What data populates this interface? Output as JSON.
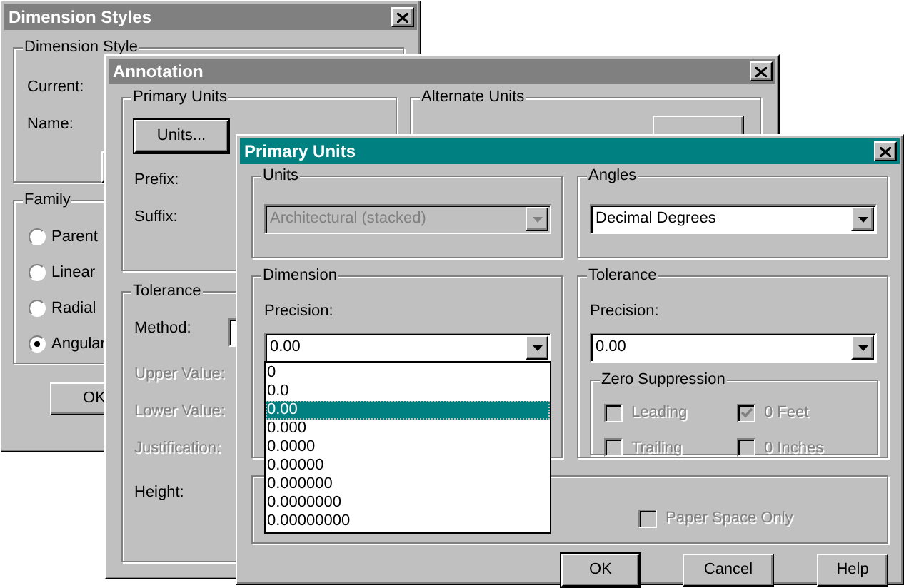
{
  "dimension_styles": {
    "title": "Dimension Styles",
    "active": false,
    "dimension_style": {
      "label": "Dimension Style",
      "fields": [
        "Current:",
        "Name:"
      ]
    },
    "family": {
      "label": "Family",
      "options": [
        {
          "label": "Parent",
          "selected": false
        },
        {
          "label": "Linear",
          "selected": false
        },
        {
          "label": "Radial",
          "selected": false
        },
        {
          "label": "Angular",
          "selected": true
        }
      ]
    },
    "buttons": [
      "OK"
    ]
  },
  "annotation": {
    "title": "Annotation",
    "active": false,
    "primary_units": {
      "label": "Primary Units",
      "button": "Units...",
      "fields": [
        "Prefix:",
        "Suffix:"
      ]
    },
    "alternate_units": {
      "label": "Alternate Units"
    },
    "tolerance": {
      "label": "Tolerance",
      "fields": [
        {
          "label": "Method:",
          "disabled": false
        },
        {
          "label": "Upper Value:",
          "disabled": true
        },
        {
          "label": "Lower Value:",
          "disabled": true
        },
        {
          "label": "Justification:",
          "disabled": true
        },
        {
          "label": "Height:",
          "disabled": false
        }
      ]
    }
  },
  "primary_units": {
    "title": "Primary Units",
    "active": true,
    "units": {
      "label": "Units",
      "value": "Architectural (stacked)",
      "disabled": true
    },
    "angles": {
      "label": "Angles",
      "value": "Decimal Degrees",
      "disabled": false
    },
    "dimension": {
      "label": "Dimension",
      "precision_label": "Precision:",
      "value": "0.00",
      "expanded": true,
      "options": [
        {
          "label": "0",
          "selected": false
        },
        {
          "label": "0.0",
          "selected": false
        },
        {
          "label": "0.00",
          "selected": true
        },
        {
          "label": "0.000",
          "selected": false
        },
        {
          "label": "0.0000",
          "selected": false
        },
        {
          "label": "0.00000",
          "selected": false
        },
        {
          "label": "0.000000",
          "selected": false
        },
        {
          "label": "0.0000000",
          "selected": false
        },
        {
          "label": "0.00000000",
          "selected": false
        }
      ]
    },
    "tolerance": {
      "label": "Tolerance",
      "precision_label": "Precision:",
      "value": "0.00",
      "zero_suppression": {
        "label": "Zero Suppression",
        "options": [
          {
            "label": "Leading",
            "checked": false,
            "disabled": true
          },
          {
            "label": "0 Feet",
            "checked": true,
            "disabled": true
          },
          {
            "label": "Trailing",
            "checked": false,
            "disabled": true
          },
          {
            "label": "0 Inches",
            "checked": false,
            "disabled": true
          }
        ]
      }
    },
    "paper_space": {
      "label": "Paper Space Only",
      "checked": false,
      "disabled": true
    },
    "buttons": [
      {
        "label": "OK",
        "default": true
      },
      {
        "label": "Cancel",
        "default": false
      },
      {
        "label": "Help",
        "default": false
      }
    ]
  }
}
